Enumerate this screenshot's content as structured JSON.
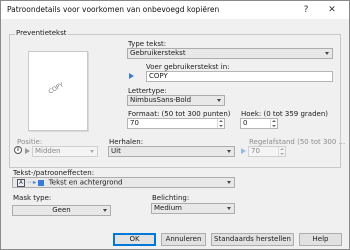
{
  "window": {
    "title": "Patroondetails voor voorkomen van onbevoegd kopiëren",
    "help_glyph": "?",
    "close_glyph": "✕"
  },
  "preventietekst": {
    "legend": "Preventietekst",
    "preview_copy_text": "COPY",
    "type_label": "Type tekst:",
    "type_value": "Gebruikerstekst",
    "custom_text_label": "Voer gebruikerstekst in:",
    "custom_text_value": "COPY",
    "font_label": "Lettertype:",
    "font_value": "NimbusSans-Bold",
    "size_label": "Formaat: (50 tot 300 punten)",
    "size_value": "70",
    "angle_label": "Hoek: (0 tot 359 graden)",
    "angle_value": "0",
    "position_label": "Positie:",
    "position_value": "Midden",
    "repeat_label": "Herhalen:",
    "repeat_value": "Uit",
    "line_spacing_label": "Regelafstand (50 tot 300 ...",
    "line_spacing_value": "70"
  },
  "effects": {
    "label": "Tekst-/patrooneffecten:",
    "value": "Tekst en achtergrond",
    "icon_text": "A",
    "mask_label": "Mask type:",
    "mask_value": "Geen",
    "exposure_label": "Belichting:",
    "exposure_value": "Medium"
  },
  "buttons": {
    "ok": "OK",
    "cancel": "Annuleren",
    "restore": "Standaards herstellen",
    "help": "Help"
  },
  "colors": {
    "accent": "#3a7bd5",
    "default_button_border": "#0078d7"
  }
}
